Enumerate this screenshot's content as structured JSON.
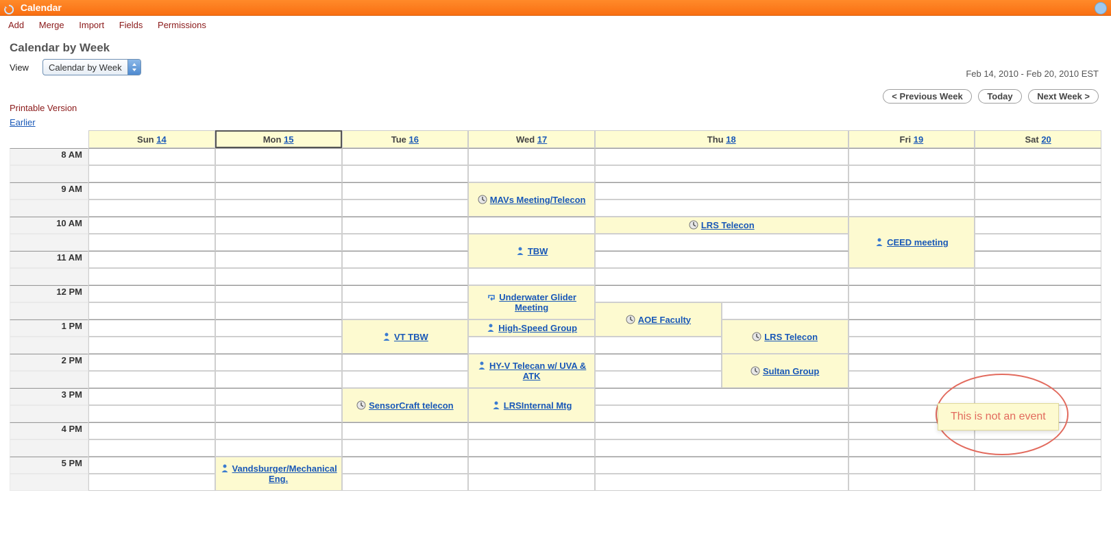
{
  "window": {
    "title": "Calendar"
  },
  "actions": {
    "add": "Add",
    "merge": "Merge",
    "import": "Import",
    "fields": "Fields",
    "permissions": "Permissions"
  },
  "page": {
    "heading": "Calendar by Week",
    "view_label": "View",
    "view_value": "Calendar by Week",
    "date_range": "Feb 14, 2010 - Feb 20, 2010 EST",
    "nav": {
      "prev": "< Previous Week",
      "today": "Today",
      "next": "Next Week >"
    },
    "printable": "Printable Version",
    "earlier": "Earlier"
  },
  "days": [
    {
      "label": "Sun",
      "date": "14"
    },
    {
      "label": "Mon",
      "date": "15"
    },
    {
      "label": "Tue",
      "date": "16"
    },
    {
      "label": "Wed",
      "date": "17"
    },
    {
      "label": "Thu",
      "date": "18"
    },
    {
      "label": "Fri",
      "date": "19"
    },
    {
      "label": "Sat",
      "date": "20"
    }
  ],
  "today_index": 1,
  "hours": [
    "8 AM",
    "9 AM",
    "10 AM",
    "11 AM",
    "12 PM",
    "1 PM",
    "2 PM",
    "3 PM",
    "4 PM",
    "5 PM"
  ],
  "events": {
    "mavs": {
      "title": "MAVs Meeting/Telecon",
      "icon": "clock",
      "day": 3,
      "slot": 2,
      "span": 2
    },
    "lrs10": {
      "title": "LRS Telecon",
      "icon": "clock",
      "day": 4,
      "slot": 4,
      "span": 1
    },
    "ceed": {
      "title": "CEED meeting",
      "icon": "person",
      "day": 5,
      "slot": 4,
      "span": 3
    },
    "tbw": {
      "title": "TBW",
      "icon": "person",
      "day": 3,
      "slot": 5,
      "span": 2
    },
    "underwater": {
      "title": "Underwater Glider Meeting",
      "icon": "return",
      "day": 3,
      "slot": 8,
      "span": 2
    },
    "aoe": {
      "title": "AOE Faculty",
      "icon": "clock",
      "day": 4,
      "slot": 9,
      "span": 2,
      "half": "left"
    },
    "vt_tbw": {
      "title": "VT TBW",
      "icon": "person",
      "day": 2,
      "slot": 10,
      "span": 2
    },
    "high_speed": {
      "title": "High-Speed Group",
      "icon": "person",
      "day": 3,
      "slot": 10,
      "span": 1
    },
    "lrs1": {
      "title": "LRS Telecon",
      "icon": "clock",
      "day": 4,
      "slot": 10,
      "span": 2,
      "half": "right"
    },
    "hyv": {
      "title": "HY-V Telecan w/ UVA & ATK",
      "icon": "person",
      "day": 3,
      "slot": 12,
      "span": 2
    },
    "sultan": {
      "title": "Sultan Group",
      "icon": "clock",
      "day": 4,
      "slot": 12,
      "span": 2,
      "half": "right"
    },
    "sensorcraft": {
      "title": "SensorCraft telecon",
      "icon": "clock",
      "day": 2,
      "slot": 14,
      "span": 2
    },
    "lrsint": {
      "title": "LRSInternal Mtg",
      "icon": "person",
      "day": 3,
      "slot": 14,
      "span": 2
    },
    "vandsburger": {
      "title": "Vandsburger/Mechanical Eng.",
      "icon": "person",
      "day": 1,
      "slot": 18,
      "span": 2
    }
  },
  "annotation": {
    "text": "This is not an event"
  }
}
